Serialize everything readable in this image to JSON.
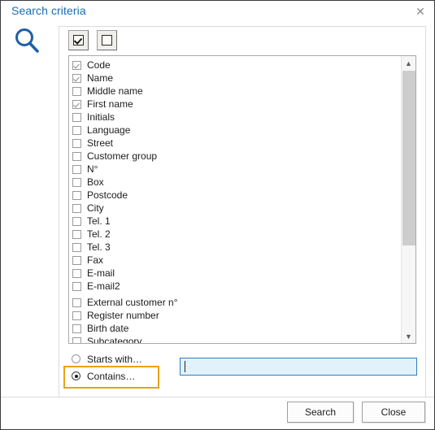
{
  "window": {
    "title": "Search criteria",
    "close_icon": "close-x-icon",
    "search_icon": "magnifier-icon"
  },
  "toolbar": {
    "select_all_label": "check-all-icon",
    "deselect_all_label": "uncheck-all-icon"
  },
  "criteria_list": [
    {
      "label": "Code",
      "checked": true
    },
    {
      "label": "Name",
      "checked": true
    },
    {
      "label": "Middle name",
      "checked": false
    },
    {
      "label": "First name",
      "checked": true
    },
    {
      "label": "Initials",
      "checked": false
    },
    {
      "label": "Language",
      "checked": false
    },
    {
      "label": "Street",
      "checked": false
    },
    {
      "label": "Customer group",
      "checked": false
    },
    {
      "label": "N°",
      "checked": false
    },
    {
      "label": "Box",
      "checked": false
    },
    {
      "label": "Postcode",
      "checked": false
    },
    {
      "label": "City",
      "checked": false
    },
    {
      "label": "Tel. 1",
      "checked": false
    },
    {
      "label": "Tel. 2",
      "checked": false
    },
    {
      "label": "Tel. 3",
      "checked": false
    },
    {
      "label": "Fax",
      "checked": false
    },
    {
      "label": "E-mail",
      "checked": false
    },
    {
      "label": "E-mail2",
      "checked": false
    },
    {
      "label": "External customer n°",
      "checked": false,
      "gap": true
    },
    {
      "label": "Register number",
      "checked": false
    },
    {
      "label": "Birth date",
      "checked": false
    },
    {
      "label": "Subcategory",
      "checked": false
    }
  ],
  "scrollbar": {
    "up_icon": "chevron-up-icon",
    "down_icon": "chevron-down-icon"
  },
  "match_mode": {
    "options": [
      {
        "label": "Starts with…",
        "selected": false
      },
      {
        "label": "Contains…",
        "selected": true
      }
    ],
    "highlighted_option": "Contains…"
  },
  "search_field": {
    "value": "",
    "placeholder": ""
  },
  "footer": {
    "search_label": "Search",
    "close_label": "Close"
  },
  "colors": {
    "title": "#1a6ab5",
    "highlight": "#e8a117",
    "input_border": "#2e7dc0",
    "input_background": "#e2f2fb"
  }
}
